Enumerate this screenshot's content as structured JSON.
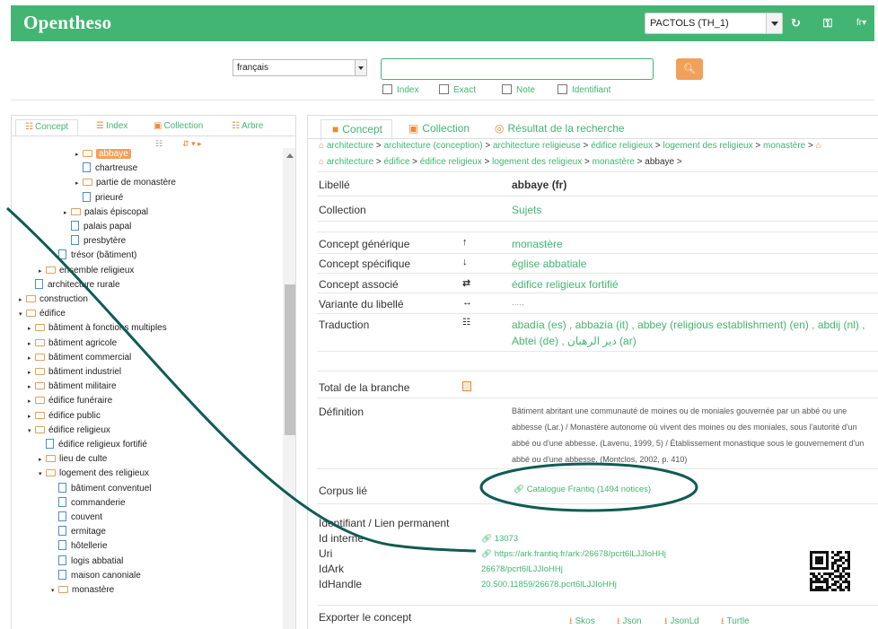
{
  "navbar": {
    "brand": "Opentheso",
    "thesaurus_value": "PACTOLS (TH_1)",
    "refresh_icon": "refresh-icon",
    "key_icon": "key-icon",
    "lang_menu": "fr▾",
    "colors": {
      "brand_green": "#43b572",
      "accent_orange": "#f0a05a"
    }
  },
  "search": {
    "language_value": "français",
    "query_value": "",
    "options": [
      "Index",
      "Exact",
      "Note",
      "Identifiant"
    ]
  },
  "left": {
    "tabs": [
      "Concept",
      "Index",
      "Collection",
      "Arbre"
    ],
    "tree": [
      {
        "label": "abbaye",
        "depth": 5,
        "kind": "folder",
        "toggle": "▸",
        "selected": true
      },
      {
        "label": "chartreuse",
        "depth": 5,
        "kind": "doc"
      },
      {
        "label": "partie de monastère",
        "depth": 5,
        "kind": "folder",
        "toggle": "▸"
      },
      {
        "label": "prieuré",
        "depth": 5,
        "kind": "doc"
      },
      {
        "label": "palais épiscopal",
        "depth": 4,
        "kind": "folder",
        "toggle": "▸"
      },
      {
        "label": "palais papal",
        "depth": 4,
        "kind": "doc"
      },
      {
        "label": "presbytère",
        "depth": 4,
        "kind": "doc"
      },
      {
        "label": "trésor (bâtiment)",
        "depth": 3,
        "kind": "doc"
      },
      {
        "label": "ensemble religieux",
        "depth": 2,
        "kind": "folder",
        "toggle": "▸"
      },
      {
        "label": "architecture rurale",
        "depth": 1,
        "kind": "doc"
      },
      {
        "label": "construction",
        "depth": 0,
        "kind": "folder",
        "toggle": "▸"
      },
      {
        "label": "édifice",
        "depth": 0,
        "kind": "folder",
        "toggle": "▾"
      },
      {
        "label": "bâtiment à fonctions multiples",
        "depth": 1,
        "kind": "folder",
        "toggle": "▸"
      },
      {
        "label": "bâtiment agricole",
        "depth": 1,
        "kind": "folder",
        "toggle": "▸"
      },
      {
        "label": "bâtiment commercial",
        "depth": 1,
        "kind": "folder",
        "toggle": "▸"
      },
      {
        "label": "bâtiment industriel",
        "depth": 1,
        "kind": "folder",
        "toggle": "▸"
      },
      {
        "label": "bâtiment militaire",
        "depth": 1,
        "kind": "folder",
        "toggle": "▸"
      },
      {
        "label": "édifice funéraire",
        "depth": 1,
        "kind": "folder",
        "toggle": "▸"
      },
      {
        "label": "édifice public",
        "depth": 1,
        "kind": "folder",
        "toggle": "▸"
      },
      {
        "label": "édifice religieux",
        "depth": 1,
        "kind": "folder",
        "toggle": "▾"
      },
      {
        "label": "édifice religieux fortifié",
        "depth": 2,
        "kind": "doc"
      },
      {
        "label": "lieu de culte",
        "depth": 2,
        "kind": "folder",
        "toggle": "▸"
      },
      {
        "label": "logement des religieux",
        "depth": 2,
        "kind": "folder",
        "toggle": "▾"
      },
      {
        "label": "bâtiment conventuel",
        "depth": 3,
        "kind": "doc"
      },
      {
        "label": "commanderie",
        "depth": 3,
        "kind": "doc"
      },
      {
        "label": "couvent",
        "depth": 3,
        "kind": "doc"
      },
      {
        "label": "ermitage",
        "depth": 3,
        "kind": "doc"
      },
      {
        "label": "hôtellerie",
        "depth": 3,
        "kind": "doc"
      },
      {
        "label": "logis abbatial",
        "depth": 3,
        "kind": "doc"
      },
      {
        "label": "maison canoniale",
        "depth": 3,
        "kind": "doc"
      },
      {
        "label": "monastère",
        "depth": 3,
        "kind": "folder",
        "toggle": "▾"
      }
    ]
  },
  "right": {
    "tabs": [
      "Concept",
      "Collection",
      "Résultat de la recherche"
    ],
    "breadcrumb1": [
      "architecture",
      "architecture (conception)",
      "architecture religieuse",
      "édifice religieux",
      "logement des religieux",
      "monastère"
    ],
    "breadcrumb2": [
      "architecture",
      "édifice",
      "édifice religieux",
      "logement des religieux",
      "monastère"
    ],
    "breadcrumb_current": "abbaye",
    "libelle_label": "Libellé",
    "libelle_value": "abbaye (fr)",
    "collection_label": "Collection",
    "collection_value": "Sujets",
    "generique_label": "Concept générique",
    "generique_value": "monastère",
    "specifique_label": "Concept spécifique",
    "specifique_value": "église abbatiale",
    "associe_label": "Concept associé",
    "associe_value": "édifice religieux fortifié",
    "variante_label": "Variante du libellé",
    "variante_value": ".....",
    "traduction_label": "Traduction",
    "traduction_line1": "abadía (es) , abbazia (it) , abbey (religious establishment) (en) , abdij (nl) ,",
    "traduction_line2": "Abtei (de) , دير الرهبان (ar)",
    "total_label": "Total de la branche",
    "definition_label": "Définition",
    "definition_text": "Bâtiment abritant une communauté de moines ou de moniales gouvernée par un abbé ou une abbesse (Lar.) / Monastère autonome où vivent des moines ou des moniales, sous l'autorité d'un abbé ou d'une abbesse. (Lavenu, 1999, 5) / Établissement monastique sous le gouvernement d'un abbé ou d'une abbesse. (Montclos, 2002, p. 410)",
    "corpus_label": "Corpus lié",
    "corpus_value": "Catalogue Frantiq (1494 notices)",
    "identifiant_label": "Identifiant / Lien permanent",
    "id_interne_label": "Id interne",
    "id_interne_value": "13073",
    "uri_label": "Uri",
    "uri_value": "https://ark.frantiq.fr/ark:/26678/pcrt6lLJJIoHHj",
    "idark_label": "IdArk",
    "idark_value": "26678/pcrt6lLJJIoHHj",
    "idhandle_label": "IdHandle",
    "idhandle_value": "20.500.11859/26678.pcrt6lLJJIoHHj",
    "export_label": "Exporter le concept",
    "export_formats": [
      "Skos",
      "Json",
      "JsonLd",
      "Turtle"
    ]
  }
}
